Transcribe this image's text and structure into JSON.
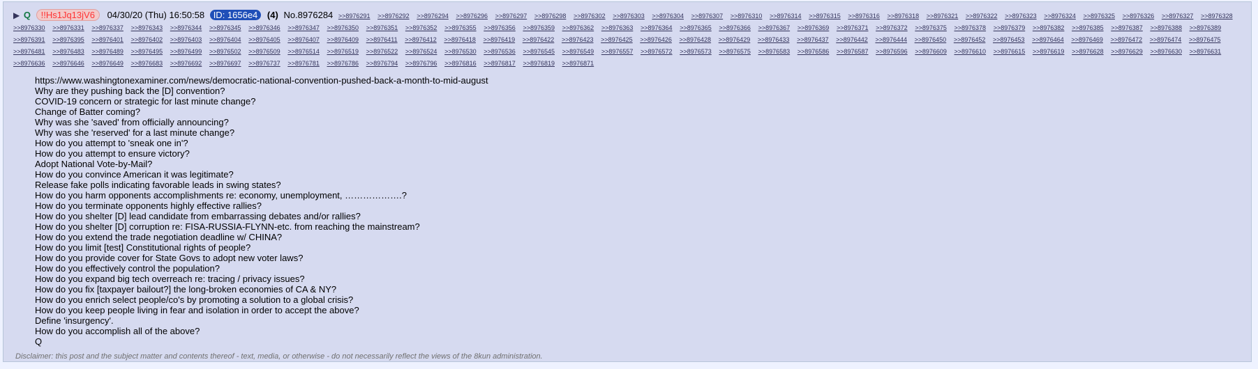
{
  "post": {
    "arrow": "▶",
    "name": "Q",
    "trip": "!!Hs1Jq13jV6",
    "date": "04/30/20 (Thu) 16:50:58",
    "id_label": "ID: 1656e4",
    "count": "(4)",
    "number": "No.8976284",
    "replies": [
      ">>8976291",
      ">>8976292",
      ">>8976294",
      ">>8976296",
      ">>8976297",
      ">>8976298",
      ">>8976302",
      ">>8976303",
      ">>8976304",
      ">>8976307",
      ">>8976310",
      ">>8976314",
      ">>8976315",
      ">>8976316",
      ">>8976318",
      ">>8976321",
      ">>8976322",
      ">>8976323",
      ">>8976324",
      ">>8976325",
      ">>8976326",
      ">>8976327",
      ">>8976328",
      ">>8976330",
      ">>8976331",
      ">>8976337",
      ">>8976343",
      ">>8976344",
      ">>8976345",
      ">>8976346",
      ">>8976347",
      ">>8976350",
      ">>8976351",
      ">>8976352",
      ">>8976355",
      ">>8976356",
      ">>8976359",
      ">>8976362",
      ">>8976363",
      ">>8976364",
      ">>8976365",
      ">>8976366",
      ">>8976367",
      ">>8976369",
      ">>8976371",
      ">>8976372",
      ">>8976375",
      ">>8976378",
      ">>8976379",
      ">>8976382",
      ">>8976385",
      ">>8976387",
      ">>8976388",
      ">>8976389",
      ">>8976391",
      ">>8976395",
      ">>8976401",
      ">>8976402",
      ">>8976403",
      ">>8976404",
      ">>8976405",
      ">>8976407",
      ">>8976409",
      ">>8976411",
      ">>8976412",
      ">>8976418",
      ">>8976419",
      ">>8976422",
      ">>8976423",
      ">>8976425",
      ">>8976426",
      ">>8976428",
      ">>8976429",
      ">>8976433",
      ">>8976437",
      ">>8976442",
      ">>8976444",
      ">>8976450",
      ">>8976452",
      ">>8976453",
      ">>8976464",
      ">>8976469",
      ">>8976472",
      ">>8976474",
      ">>8976475",
      ">>8976481",
      ">>8976483",
      ">>8976489",
      ">>8976495",
      ">>8976499",
      ">>8976502",
      ">>8976509",
      ">>8976514",
      ">>8976519",
      ">>8976522",
      ">>8976524",
      ">>8976530",
      ">>8976536",
      ">>8976545",
      ">>8976549",
      ">>8976557",
      ">>8976572",
      ">>8976573",
      ">>8976575",
      ">>8976583",
      ">>8976586",
      ">>8976587",
      ">>8976596",
      ">>8976609",
      ">>8976610",
      ">>8976615",
      ">>8976619",
      ">>8976628",
      ">>8976629",
      ">>8976630",
      ">>8976631",
      ">>8976636",
      ">>8976646",
      ">>8976649",
      ">>8976683",
      ">>8976692",
      ">>8976697",
      ">>8976737",
      ">>8976781",
      ">>8976786",
      ">>8976794",
      ">>8976796",
      ">>8976816",
      ">>8976817",
      ">>8976819",
      ">>8976871"
    ],
    "body_lines": [
      "https://www.washingtonexaminer.com/news/democratic-national-convention-pushed-back-a-month-to-mid-august",
      "Why are they pushing back the [D] convention?",
      "COVID-19 concern or strategic for last minute change?",
      "Change of Batter coming?",
      "Why was she 'saved' from officially announcing?",
      "Why was she 'reserved' for a last minute change?",
      "How do you attempt to 'sneak one in'?",
      "How do you attempt to ensure victory?",
      "Adopt National Vote-by-Mail?",
      "How do you convince American it was legitimate?",
      "Release fake polls indicating favorable leads in swing states?",
      "How do you harm opponents accomplishments re: economy, unemployment, ……………….?",
      "How do you terminate opponents highly effective rallies?",
      "How do you shelter [D] lead candidate from embarrassing debates and/or rallies?",
      "How do you shelter [D] corruption re: FISA-RUSSIA-FLYNN-etc. from reaching the mainstream?",
      "How do you extend the trade negotiation deadline w/ CHINA?",
      "How do you limit [test] Constitutional rights of people?",
      "How do you provide cover for State Govs to adopt new voter laws?",
      "How do you effectively control the population?",
      "How do you expand big tech overreach re: tracing / privacy issues?",
      "How do you fix [taxpayer bailout?] the long-broken economies of CA & NY?",
      "How do you enrich select people/co's by promoting a solution to a global crisis?",
      "How do you keep people living in fear and isolation in order to accept the above?",
      "Define 'insurgency'.",
      "How do you accomplish all of the above?",
      "Q"
    ],
    "disclaimer": "Disclaimer: this post and the subject matter and contents thereof - text, media, or otherwise - do not necessarily reflect the views of the 8kun administration."
  }
}
